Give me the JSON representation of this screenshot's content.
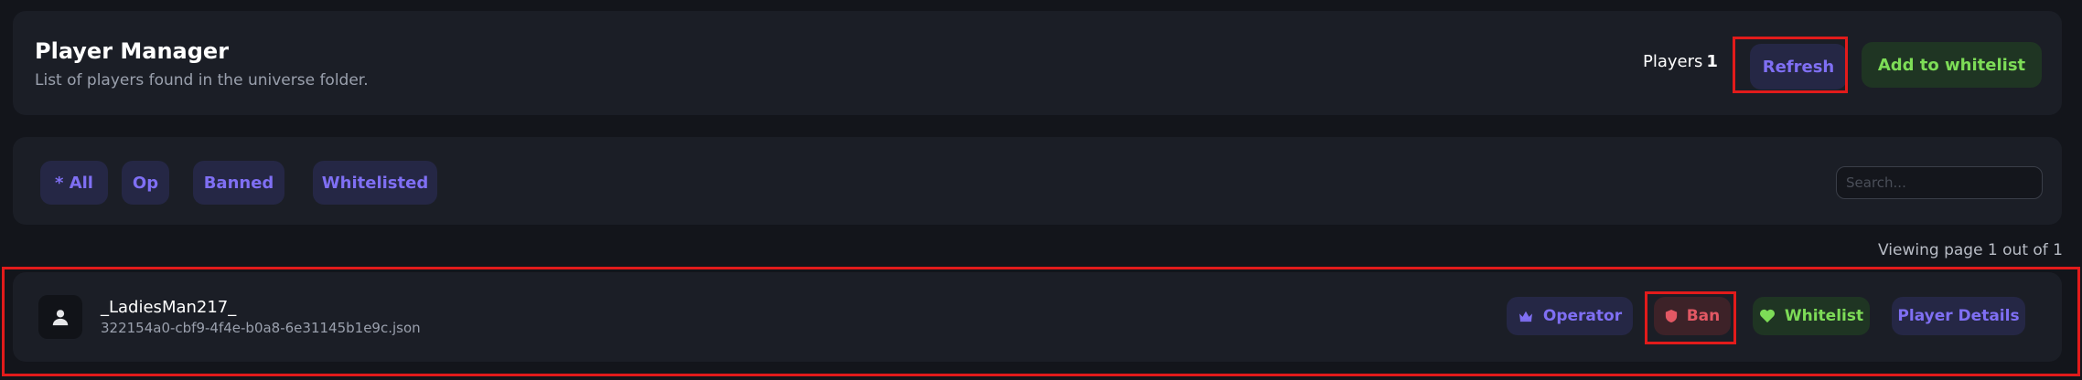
{
  "header": {
    "title": "Player Manager",
    "subtitle": "List of players found in the universe folder.",
    "players_label": "Players",
    "players_count": "1",
    "refresh_label": "Refresh",
    "add_whitelist_label": "Add to whitelist"
  },
  "filters": {
    "tabs": [
      {
        "label": "* All"
      },
      {
        "label": "Op"
      },
      {
        "label": "Banned"
      },
      {
        "label": "Whitelisted"
      }
    ],
    "search_placeholder": "Search..."
  },
  "pagination": {
    "text": "Viewing page 1 out of 1"
  },
  "players": [
    {
      "name": "_LadiesMan217_",
      "file": "322154a0-cbf9-4f4e-b0a8-6e31145b1e9c.json",
      "actions": {
        "operator_label": "Operator",
        "ban_label": "Ban",
        "whitelist_label": "Whitelist",
        "details_label": "Player Details"
      }
    }
  ],
  "colors": {
    "background": "#13151b",
    "card": "#1b1e26",
    "accent_purple": "#7f6ff3",
    "accent_green": "#7ddc57",
    "accent_red": "#e25864",
    "highlight_red": "#e21b1b"
  },
  "icons": {
    "operator": "crown-icon",
    "ban": "shield-icon",
    "whitelist": "heart-icon",
    "avatar": "user-icon"
  }
}
